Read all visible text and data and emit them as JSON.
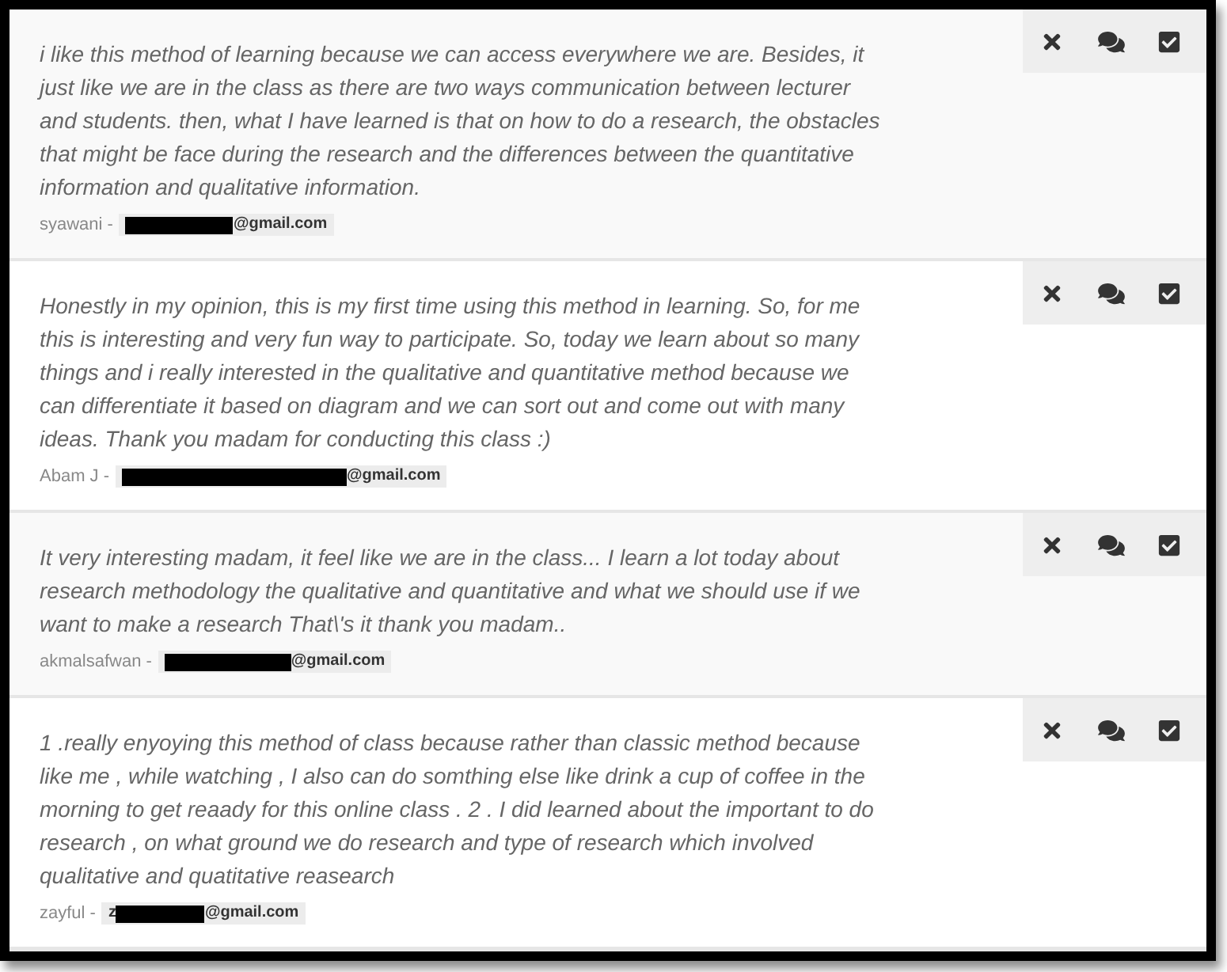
{
  "responses": [
    {
      "text": "i like this method of learning because we can access everywhere we are. Besides, it just like we are in the class as there are two ways communication between lecturer and students. then, what I have learned is that on how to do a research, the obstacles that might be face during the research and the differences between the quantitative information and qualitative information.",
      "author": "syawani -",
      "email": {
        "suffix": "@gmail.com"
      }
    },
    {
      "text": "Honestly in my opinion, this is my first time using this method in learning. So, for me this is interesting and very fun way to participate. So, today we learn about so many things and i really interested in the qualitative and quantitative method because we can differentiate it based on diagram and we can sort out and come out with many ideas. Thank you madam for conducting this class :)",
      "author": "Abam J -",
      "email": {
        "suffix": "@gmail.com"
      }
    },
    {
      "text": "It very interesting madam, it feel like we are in the class... I learn a lot today about research methodology the qualitative and quantitative and what we should use if we want to make a research That\\'s it thank you madam..",
      "author": "akmalsafwan -",
      "email": {
        "suffix": "@gmail.com"
      }
    },
    {
      "text": "1 .really enyoying this method of class because rather than classic method because like me , while watching , I also can do somthing else like drink a cup of coffee in the morning to get reaady for this online class . 2 . I did learned about the important to do research , on what ground we do research and type of research which involved qualitative and quatitative reasearch",
      "author": "zayful -",
      "email": {
        "prefix": "z",
        "suffix": "@gmail.com"
      }
    }
  ]
}
